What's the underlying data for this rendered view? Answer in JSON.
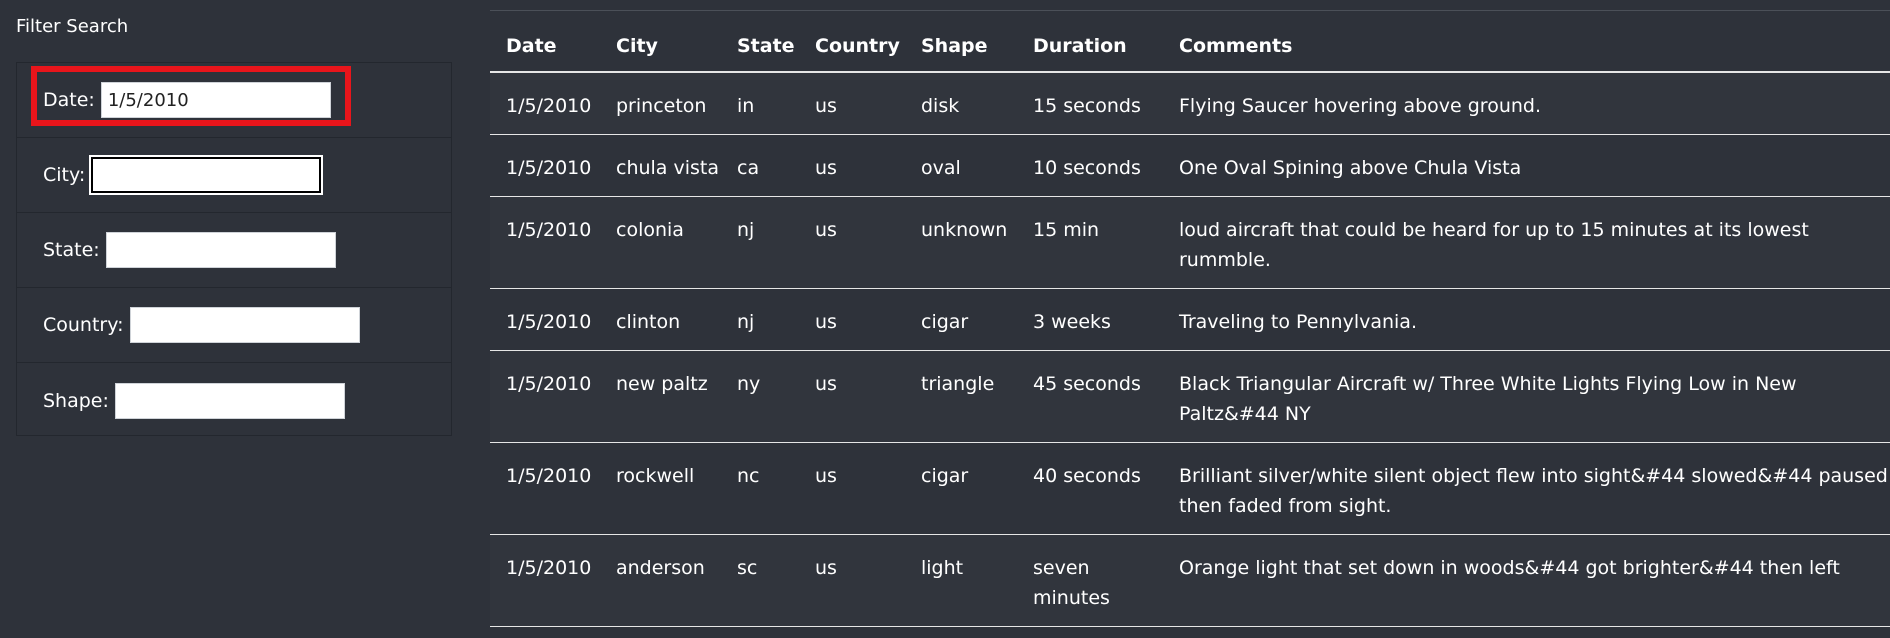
{
  "filter": {
    "title": "Filter Search",
    "fields": [
      {
        "label": "Date:",
        "value": "1/5/2010"
      },
      {
        "label": "City:",
        "value": ""
      },
      {
        "label": "State:",
        "value": ""
      },
      {
        "label": "Country:",
        "value": ""
      },
      {
        "label": "Shape:",
        "value": ""
      }
    ]
  },
  "colors": {
    "background": "#2e323a",
    "highlight": "#e8151b",
    "text": "#ffffff"
  },
  "table": {
    "headers": [
      "Date",
      "City",
      "State",
      "Country",
      "Shape",
      "Duration",
      "Comments"
    ],
    "rows": [
      [
        "1/5/2010",
        "princeton",
        "in",
        "us",
        "disk",
        "15 seconds",
        "Flying Saucer hovering above ground."
      ],
      [
        "1/5/2010",
        "chula vista",
        "ca",
        "us",
        "oval",
        "10 seconds",
        "One Oval Spining above Chula Vista"
      ],
      [
        "1/5/2010",
        "colonia",
        "nj",
        "us",
        "unknown",
        "15 min",
        "loud aircraft that could be heard for up to 15 minutes at its lowest rummble."
      ],
      [
        "1/5/2010",
        "clinton",
        "nj",
        "us",
        "cigar",
        "3 weeks",
        "Traveling to Pennylvania."
      ],
      [
        "1/5/2010",
        "new paltz",
        "ny",
        "us",
        "triangle",
        "45 seconds",
        "Black Triangular Aircraft w/ Three White Lights Flying Low in New Paltz&#44 NY"
      ],
      [
        "1/5/2010",
        "rockwell",
        "nc",
        "us",
        "cigar",
        "40 seconds",
        "Brilliant silver/white silent object flew into sight&#44 slowed&#44 paused then faded from sight."
      ],
      [
        "1/5/2010",
        "anderson",
        "sc",
        "us",
        "light",
        "seven minutes",
        "Orange light that set down in woods&#44 got brighter&#44 then left"
      ]
    ]
  }
}
